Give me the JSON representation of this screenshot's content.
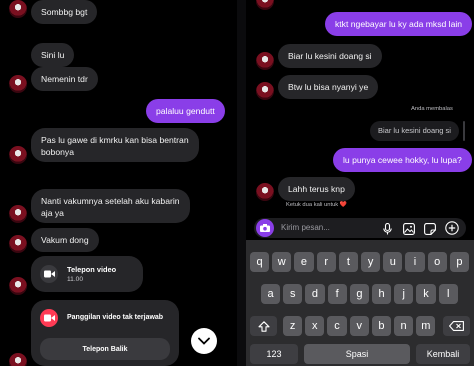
{
  "left": {
    "messages": [
      {
        "text": "Sombbg bgt"
      },
      {
        "text": "Sini lu"
      },
      {
        "text": "Nemenin tdr"
      },
      {
        "text": "palaluu gendutt"
      },
      {
        "text": "Pas lu gawe di kmrku kan bisa bentran"
      },
      {
        "text": "bobonya"
      },
      {
        "text": "Nanti vakumnya setelah aku kabarin"
      },
      {
        "text": "aja ya"
      },
      {
        "text": "Vakum dong"
      }
    ],
    "video_call": {
      "title": "Telepon video",
      "time": "11.00"
    },
    "missed_call": {
      "title": "Panggilan video tak terjawab",
      "callback": "Telepon Balik"
    }
  },
  "right": {
    "messages": [
      {
        "text": "ktkt ngebayar lu ky ada mksd lain"
      },
      {
        "text": "Biar lu kesini doang si"
      },
      {
        "text": "Btw lu bisa nyanyi ye"
      },
      {
        "text": "Biar lu kesini doang si"
      },
      {
        "text": "lu punya cewee hokky, lu lupa?"
      },
      {
        "text": "Lahh terus knp"
      }
    ],
    "reply_label": "Anda membalas",
    "reaction_hint": "Ketuk dua kali untuk",
    "reaction_emoji": "❤️",
    "composer_placeholder": "Kirim pesan...",
    "keyboard": {
      "row1": [
        "q",
        "w",
        "e",
        "r",
        "t",
        "y",
        "u",
        "i",
        "o",
        "p"
      ],
      "row2": [
        "a",
        "s",
        "d",
        "f",
        "g",
        "h",
        "j",
        "k",
        "l"
      ],
      "row3": [
        "z",
        "x",
        "c",
        "v",
        "b",
        "n",
        "m"
      ],
      "numbers_key": "123",
      "space_key": "Spasi",
      "return_key": "Kembali"
    }
  },
  "colors": {
    "accent": "#8a3ee8",
    "bubble": "#262629",
    "background": "#000000",
    "missed": "#ff3b55",
    "keyboard": "#2c2c2e",
    "key": "#5a5a5e"
  }
}
